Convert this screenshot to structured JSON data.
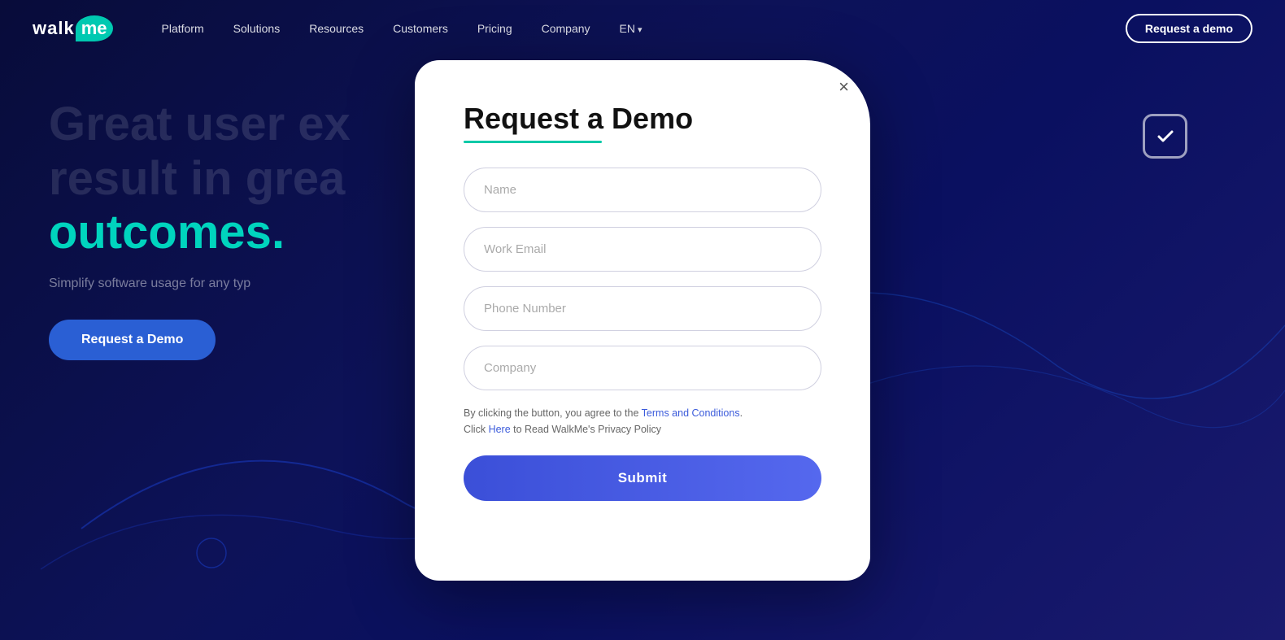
{
  "brand": {
    "name_walk": "walk",
    "name_me": "me"
  },
  "nav": {
    "links": [
      {
        "label": "Platform",
        "hasArrow": false
      },
      {
        "label": "Solutions",
        "hasArrow": false
      },
      {
        "label": "Resources",
        "hasArrow": false
      },
      {
        "label": "Customers",
        "hasArrow": false
      },
      {
        "label": "Pricing",
        "hasArrow": false
      },
      {
        "label": "Company",
        "hasArrow": false
      },
      {
        "label": "EN",
        "hasArrow": true
      }
    ],
    "demo_button": "Request a demo"
  },
  "hero": {
    "line1": "Great user ex",
    "line2": "result in grea",
    "line3": "outcomes.",
    "accent_text": "outcomes.",
    "subtitle": "Simplify software usage for any typ",
    "cta_button": "Request a Demo"
  },
  "modal": {
    "title": "Request a Demo",
    "close_label": "×",
    "fields": [
      {
        "placeholder": "Name",
        "type": "text",
        "name": "name"
      },
      {
        "placeholder": "Work Email",
        "type": "email",
        "name": "work_email"
      },
      {
        "placeholder": "Phone Number",
        "type": "tel",
        "name": "phone"
      },
      {
        "placeholder": "Company",
        "type": "text",
        "name": "company"
      }
    ],
    "consent_part1": "By clicking the button, you agree to the ",
    "consent_link1": "Terms and Conditions",
    "consent_part2": ".",
    "consent_part3": " Click ",
    "consent_link2": "Here",
    "consent_part4": " to Read WalkMe's Privacy Policy",
    "submit_button": "Submit"
  }
}
